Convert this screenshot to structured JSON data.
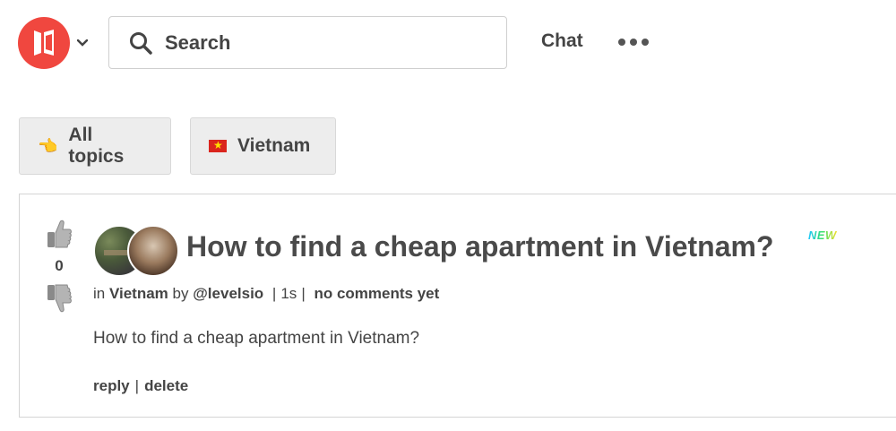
{
  "header": {
    "search": {
      "placeholder": "Search"
    },
    "chat_label": "Chat",
    "colors": {
      "logo": "#f0473f"
    }
  },
  "topics": [
    {
      "emoji": "👈",
      "label": "All topics"
    },
    {
      "emoji": "🇻🇳",
      "label": "Vietnam"
    }
  ],
  "post": {
    "score": "0",
    "title": "How to find a cheap apartment in Vietnam?",
    "badge": "NEW",
    "meta": {
      "in_label": "in",
      "topic": "Vietnam",
      "by_label": "by",
      "author": "@levelsio",
      "time": "1s",
      "comments": "no comments yet"
    },
    "body": "How to find a cheap apartment in Vietnam?",
    "actions": {
      "reply": "reply",
      "delete": "delete"
    }
  }
}
